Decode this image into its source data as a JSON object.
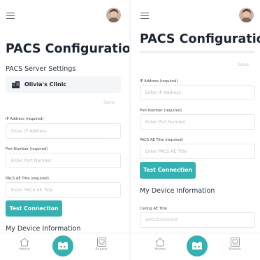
{
  "left": {
    "title": "PACS Configuration",
    "server_settings_heading": "PACS Server Settings",
    "clinic_name": "Olivia's Clinic",
    "save_label": "Save",
    "ip_label": "IP Address (required)",
    "ip_placeholder": "Enter IP Address",
    "port_label": "Port Number (required)",
    "port_placeholder": "Enter Port Number",
    "ae_label": "PACS AE Title (required)",
    "ae_placeholder": "Enter PACS AE Title",
    "test_button": "Test Connection",
    "device_heading": "My Device Information"
  },
  "right": {
    "title": "PACS Configuration",
    "save_label": "Save",
    "ip_label": "IP Address (required)",
    "ip_placeholder": "Enter IP Address",
    "port_label": "Port Number (required)",
    "port_placeholder": "Enter Port Number",
    "ae_label": "PACS AE Title (required)",
    "ae_placeholder": "Enter PACS AE Title",
    "test_button": "Test Connection",
    "device_heading": "My Device Information",
    "calling_label": "Calling AE Title",
    "calling_value": "webultrasound"
  },
  "tabbar": {
    "home_label": "Home",
    "exams_label": "Exams",
    "icons": [
      "home-icon",
      "scan-icon",
      "exams-icon"
    ]
  },
  "colors": {
    "accent": "#34b1b0",
    "title": "#1d2533",
    "muted": "#b8bcc2"
  }
}
